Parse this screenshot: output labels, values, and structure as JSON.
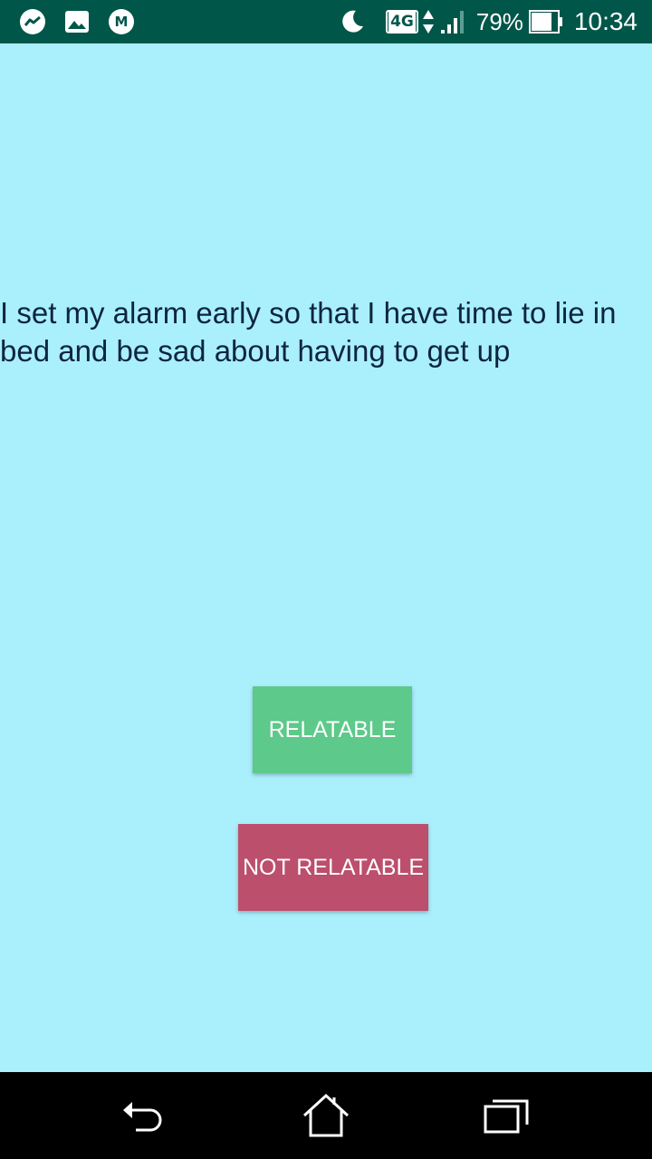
{
  "status_bar": {
    "notification_icons": [
      "messenger-icon",
      "gallery-icon",
      "gmail-icon"
    ],
    "network_type": "4G",
    "battery_percent": "79%",
    "time": "10:34",
    "background_color": "#01564a"
  },
  "main": {
    "background_color": "#aaeffc",
    "quote": "I set my alarm early so that I have time to lie in bed and be sad about having to get up",
    "relatable_button": {
      "label": "RELATABLE",
      "color": "#5dc98a"
    },
    "not_relatable_button": {
      "label": "NOT RELATABLE",
      "color": "#bc4f6c"
    }
  },
  "nav_bar": {
    "buttons": [
      "back-icon",
      "home-icon",
      "recents-icon"
    ]
  }
}
